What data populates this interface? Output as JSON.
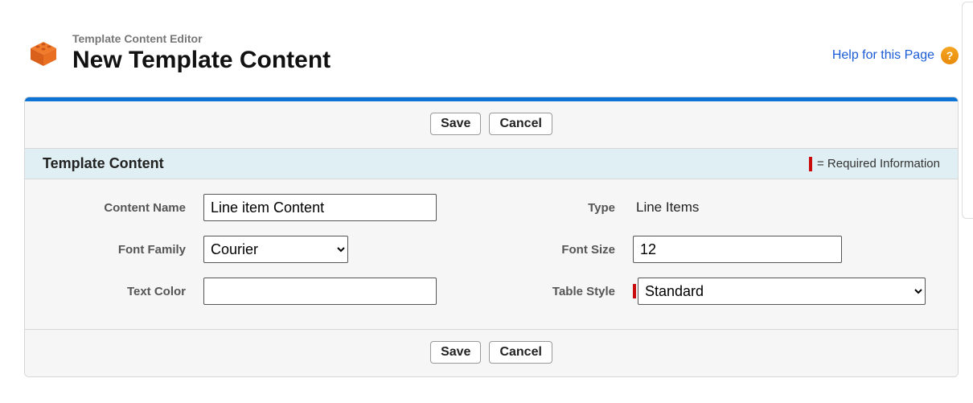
{
  "header": {
    "subtitle": "Template Content Editor",
    "title": "New Template Content",
    "help_label": "Help for this Page"
  },
  "buttons": {
    "save": "Save",
    "cancel": "Cancel"
  },
  "section": {
    "title": "Template Content",
    "required_note": "= Required Information"
  },
  "form": {
    "content_name": {
      "label": "Content Name",
      "value": "Line item Content"
    },
    "type": {
      "label": "Type",
      "value": "Line Items"
    },
    "font_family": {
      "label": "Font Family",
      "value": "Courier"
    },
    "font_size": {
      "label": "Font Size",
      "value": "12"
    },
    "text_color": {
      "label": "Text Color",
      "value": ""
    },
    "table_style": {
      "label": "Table Style",
      "value": "Standard"
    }
  }
}
